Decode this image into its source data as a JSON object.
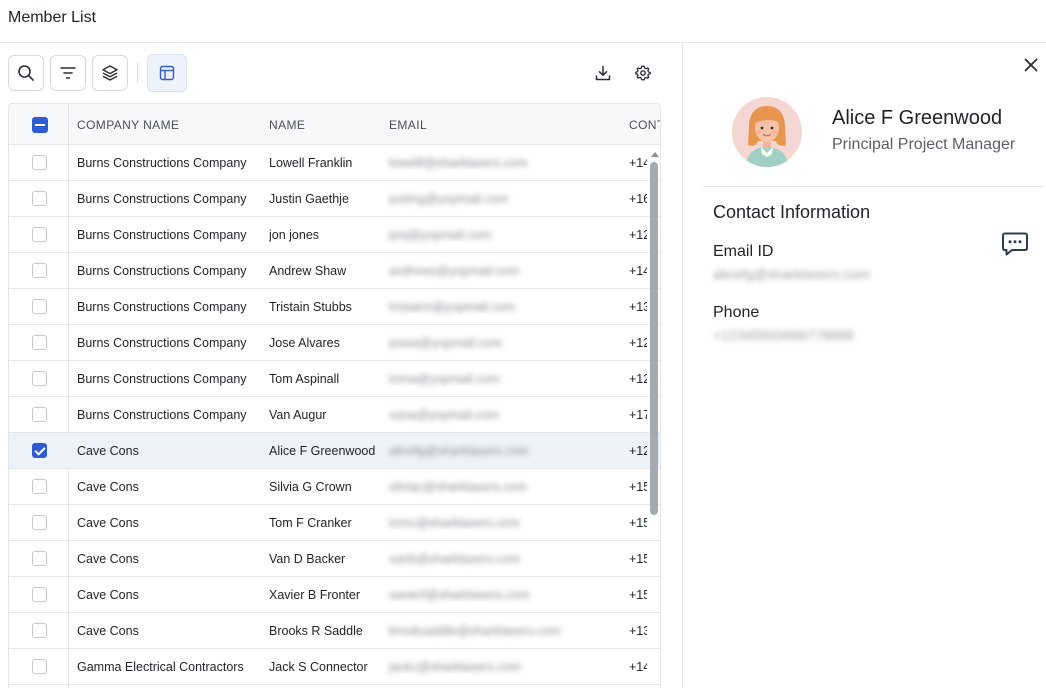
{
  "page": {
    "title": "Member List"
  },
  "toolbar": {
    "search_icon": "search-icon",
    "filter_icon": "filter-icon",
    "layers_icon": "layers-icon",
    "layout_icon": "table-layout-icon",
    "download_icon": "download-icon",
    "settings_icon": "gear-icon"
  },
  "table": {
    "columns": [
      "COMPANY NAME",
      "NAME",
      "EMAIL",
      "CONTACT"
    ],
    "rows": [
      {
        "company": "Burns Constructions Company",
        "name": "Lowell Franklin",
        "email": "lowellf@sharklasers.com",
        "contact": "+14",
        "checked": false
      },
      {
        "company": "Burns Constructions Company",
        "name": "Justin Gaethje",
        "email": "justing@yopmail.com",
        "contact": "+16",
        "checked": false
      },
      {
        "company": "Burns Constructions Company",
        "name": "jon jones",
        "email": "jonj@yopmail.com",
        "contact": "+12",
        "checked": false
      },
      {
        "company": "Burns Constructions Company",
        "name": "Andrew Shaw",
        "email": "andrews@yopmail.com",
        "contact": "+14",
        "checked": false
      },
      {
        "company": "Burns Constructions Company",
        "name": "Tristain Stubbs",
        "email": "tristains@yopmail.com",
        "contact": "+13",
        "checked": false
      },
      {
        "company": "Burns Constructions Company",
        "name": "Jose Alvares",
        "email": "josea@yopmail.com",
        "contact": "+12",
        "checked": false
      },
      {
        "company": "Burns Constructions Company",
        "name": "Tom Aspinall",
        "email": "toma@yopmail.com",
        "contact": "+12",
        "checked": false
      },
      {
        "company": "Burns Constructions Company",
        "name": "Van Augur",
        "email": "vana@yopmail.com",
        "contact": "+17",
        "checked": false
      },
      {
        "company": "Cave Cons",
        "name": "Alice F Greenwood",
        "email": "alicefg@sharklasers.com",
        "contact": "+12",
        "checked": true
      },
      {
        "company": "Cave Cons",
        "name": "Silvia G Crown",
        "email": "silviac@sharklasers.com",
        "contact": "+15",
        "checked": false
      },
      {
        "company": "Cave Cons",
        "name": "Tom F Cranker",
        "email": "tomc@sharklasers.com",
        "contact": "+15",
        "checked": false
      },
      {
        "company": "Cave Cons",
        "name": "Van D Backer",
        "email": "vanb@sharklasers.com",
        "contact": "+15",
        "checked": false
      },
      {
        "company": "Cave Cons",
        "name": "Xavier B Fronter",
        "email": "xavierf@sharklasers.com",
        "contact": "+15",
        "checked": false
      },
      {
        "company": "Cave Cons",
        "name": "Brooks R Saddle",
        "email": "brooksaddle@sharklasers.com",
        "contact": "+13",
        "checked": false
      },
      {
        "company": "Gamma Electrical Contractors",
        "name": "Jack S Connector",
        "email": "jackc@sharklasers.com",
        "contact": "+14",
        "checked": false
      }
    ]
  },
  "detail": {
    "close_icon": "close-icon",
    "avatar_icon": "avatar",
    "name": "Alice F Greenwood",
    "role": "Principal Project Manager",
    "section_title": "Contact Information",
    "message_icon": "chat-bubble-icon",
    "email_label": "Email ID",
    "email_value": "alicefg@sharklasers.com",
    "phone_label": "Phone",
    "phone_value": "+12345555666778888"
  },
  "colors": {
    "accent": "#2f5bd3",
    "selected_row": "#eef3fb",
    "border": "#e3e5e8"
  }
}
